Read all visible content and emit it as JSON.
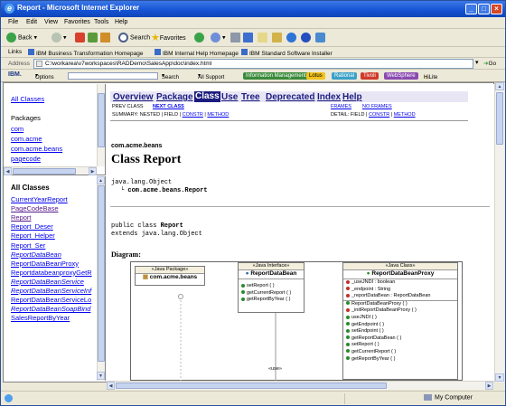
{
  "window": {
    "title": "Report - Microsoft Internet Explorer",
    "controls": [
      "_",
      "□",
      "×"
    ]
  },
  "menu": [
    "File",
    "Edit",
    "View",
    "Favorites",
    "Tools",
    "Help"
  ],
  "toolbar": {
    "back": "Back",
    "search": "Search",
    "favorites": "Favorites"
  },
  "links": {
    "label": "Links",
    "items": [
      "IBM Business Transformation Homepage",
      "IBM Internal Help Homepage",
      "IBM Standard Software Installer"
    ]
  },
  "address": {
    "label": "Address",
    "value": "C:\\workarea\\v7workspaces\\RADDemo\\SalesApp\\doc\\index.html",
    "go": "Go"
  },
  "ibm_toolbar": {
    "logo": "IBM.",
    "options": "Options",
    "search": "Search",
    "support": "All Support",
    "pills": [
      "Information Management",
      "Lotus",
      "Rational",
      "Tivoli",
      "WebSphere"
    ],
    "hilite": "HiLite"
  },
  "packages_frame": {
    "all_classes": "All Classes",
    "heading": "Packages",
    "items": [
      "com",
      "com.acme",
      "com.acme.beans",
      "pagecode"
    ]
  },
  "classes_frame": {
    "heading": "All Classes",
    "items": [
      {
        "label": "CurrentYearReport",
        "italic": false,
        "visited": false
      },
      {
        "label": "PageCodeBase",
        "italic": false,
        "visited": true
      },
      {
        "label": "Report",
        "italic": false,
        "visited": true
      },
      {
        "label": "Report_Deser",
        "italic": false,
        "visited": false
      },
      {
        "label": "Report_Helper",
        "italic": false,
        "visited": false
      },
      {
        "label": "Report_Ser",
        "italic": false,
        "visited": false
      },
      {
        "label": "ReportDataBean",
        "italic": true,
        "visited": false
      },
      {
        "label": "ReportDataBeanProxy",
        "italic": false,
        "visited": false
      },
      {
        "label": "ReportdatabeanproxyGetR",
        "italic": false,
        "visited": false
      },
      {
        "label": "ReportDataBeanService",
        "italic": true,
        "visited": false
      },
      {
        "label": "ReportDataBeanServiceInf",
        "italic": true,
        "visited": false
      },
      {
        "label": "ReportDataBeanServiceLo",
        "italic": false,
        "visited": false
      },
      {
        "label": "ReportDataBeanSoapBind",
        "italic": true,
        "visited": false
      },
      {
        "label": "SalesReportByYear",
        "italic": false,
        "visited": false
      }
    ]
  },
  "nav": {
    "items": [
      "Overview",
      "Package",
      "Class",
      "Use",
      "Tree",
      "Deprecated",
      "Index",
      "Help"
    ],
    "current": "Class"
  },
  "subnav": {
    "prev": "PREV CLASS",
    "next": "NEXT CLASS",
    "frames": "FRAMES",
    "noframes": "NO FRAMES",
    "summary_label": "SUMMARY: NESTED | FIELD | ",
    "summary_constr": "CONSTR",
    "sep": " | ",
    "summary_method": "METHOD",
    "detail_label": "DETAIL: FIELD | ",
    "detail_constr": "CONSTR",
    "detail_method": "METHOD"
  },
  "doc": {
    "package": "com.acme.beans",
    "title": "Class Report",
    "hier1": "java.lang.Object",
    "hier2": "com.acme.beans.Report",
    "decl_pre": "public class ",
    "decl_name": "Report",
    "decl_ext": "extends java.lang.Object",
    "diagram": "Diagram:"
  },
  "diagram": {
    "pkg": {
      "stereo": "«Java Package»",
      "name": "com.acme.beans"
    },
    "iface": {
      "stereo": "«Java Interface»",
      "name": "ReportDataBean",
      "methods": [
        "setReport ( )",
        "getCurrentReport ( )",
        "getReportByYear ( )"
      ]
    },
    "cls": {
      "stereo": "«Java Class»",
      "name": "ReportDataBeanProxy",
      "fields": [
        "_useJNDI : boolean",
        "_endpoint : String",
        "_reportDataBean : ReportDataBean"
      ],
      "methods": [
        "ReportDataBeanProxy ( )",
        "_initReportDataBeanProxy ( )",
        "useJNDI ( )",
        "getEndpoint ( )",
        "setEndpoint ( )",
        "getReportDataBean ( )",
        "setReport ( )",
        "getCurrentReport ( )",
        "getReportByYear ( )"
      ]
    },
    "use": "«use»"
  },
  "status": {
    "zone": "My Computer"
  }
}
